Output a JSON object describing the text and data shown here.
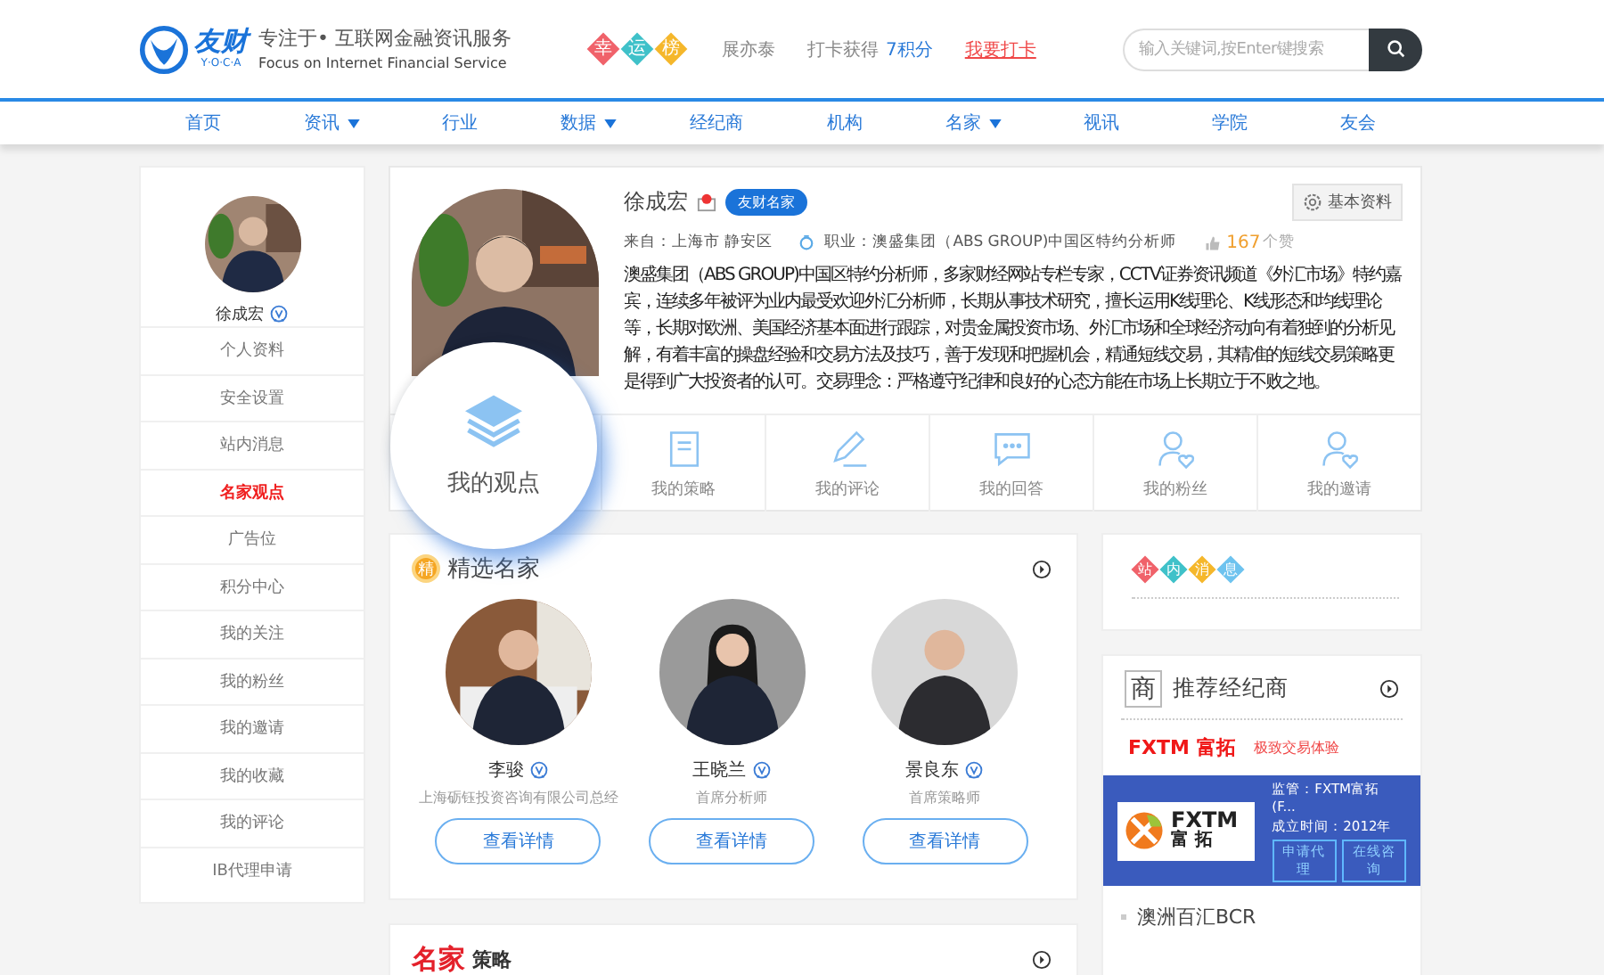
{
  "header": {
    "logo": {
      "brand": "友财",
      "letters": "Y·O·C·A"
    },
    "slogan": "专注于• 互联网金融资讯服务",
    "slogan_en": "Focus on Internet Financial Service",
    "lucky_badge": [
      "幸",
      "运",
      "榜"
    ],
    "user": "展亦泰",
    "checkin_text": "打卡获得",
    "checkin_points": "7积分",
    "checkin_link": "我要打卡",
    "search": {
      "placeholder": "输入关键词,按Enter键搜索"
    }
  },
  "nav": [
    {
      "label": "首页",
      "has_menu": false
    },
    {
      "label": "资讯",
      "has_menu": true
    },
    {
      "label": "行业",
      "has_menu": false
    },
    {
      "label": "数据",
      "has_menu": true
    },
    {
      "label": "经纪商",
      "has_menu": false
    },
    {
      "label": "机构",
      "has_menu": false
    },
    {
      "label": "名家",
      "has_menu": true
    },
    {
      "label": "视讯",
      "has_menu": false
    },
    {
      "label": "学院",
      "has_menu": false
    },
    {
      "label": "友会",
      "has_menu": false
    }
  ],
  "sidebar": {
    "name": "徐成宏",
    "items": [
      {
        "label": "个人资料",
        "selected": false
      },
      {
        "label": "安全设置",
        "selected": false
      },
      {
        "label": "站内消息",
        "selected": false
      },
      {
        "label": "名家观点",
        "selected": true
      },
      {
        "label": "广告位",
        "selected": false
      },
      {
        "label": "积分中心",
        "selected": false
      },
      {
        "label": "我的关注",
        "selected": false
      },
      {
        "label": "我的粉丝",
        "selected": false
      },
      {
        "label": "我的邀请",
        "selected": false
      },
      {
        "label": "我的收藏",
        "selected": false
      },
      {
        "label": "我的评论",
        "selected": false
      },
      {
        "label": "IB代理申请",
        "selected": false
      }
    ]
  },
  "profile": {
    "name": "徐成宏",
    "badge": "友财名家",
    "settings_button": "基本资料",
    "from": "来自：上海市  静安区",
    "job": "职业：澳盛集团（ABS GROUP)中国区特约分析师",
    "likes": "167",
    "likes_unit": "个赞",
    "bio": "澳盛集团（ABS GROUP)中国区特约分析师，多家财经网站专栏专家，CCTV证券资讯频道《外汇市场》特约嘉宾，连续多年被评为业内最受欢迎外汇分析师，长期从事技术研究，擅长运用K线理论、K线形态和均线理论等，长期对欧洲、美国经济基本面进行跟踪，对贵金属投资市场、外汇市场和全球经济动向有着独到的分析见解，有着丰富的操盘经验和交易方法及技巧，善于发现和把握机会，精通短线交易，其精准的短线交易策略更是得到广大投资者的认可。交易理念：严格遵守纪律和良好的心态方能在市场上长期立于不败之地。"
  },
  "magnifier": {
    "label": "我的观点"
  },
  "tiles": [
    {
      "label": "我的策略",
      "kind": "strategy"
    },
    {
      "label": "我的评论",
      "kind": "comment"
    },
    {
      "label": "我的回答",
      "kind": "answer"
    },
    {
      "label": "我的粉丝",
      "kind": "fans"
    },
    {
      "label": "我的邀请",
      "kind": "invite"
    }
  ],
  "featured": {
    "badge": "精",
    "title": "精选名家",
    "experts": [
      {
        "name": "李骏",
        "title": "上海砺钰投资咨询有限公司总经",
        "button": "查看详情"
      },
      {
        "name": "王晓兰",
        "title": "首席分析师",
        "button": "查看详情"
      },
      {
        "name": "景良东",
        "title": "首席策略师",
        "button": "查看详情"
      }
    ]
  },
  "strategy": {
    "title_red": "名家",
    "title": "策略"
  },
  "messages": {
    "badge": [
      "站",
      "内",
      "消",
      "息"
    ]
  },
  "brokers": {
    "icon": "商",
    "title": "推荐经纪商",
    "featured": {
      "name": "FXTM 富拓",
      "tagline": "极致交易体验",
      "logo_text": "FXTM",
      "logo_cn": "富 拓",
      "regulator": "监管：FXTM富拓 (F...",
      "founded": "成立时间：2012年",
      "buttons": [
        "申请代理",
        "在线咨询"
      ]
    },
    "others": [
      "澳洲百汇BCR"
    ]
  }
}
